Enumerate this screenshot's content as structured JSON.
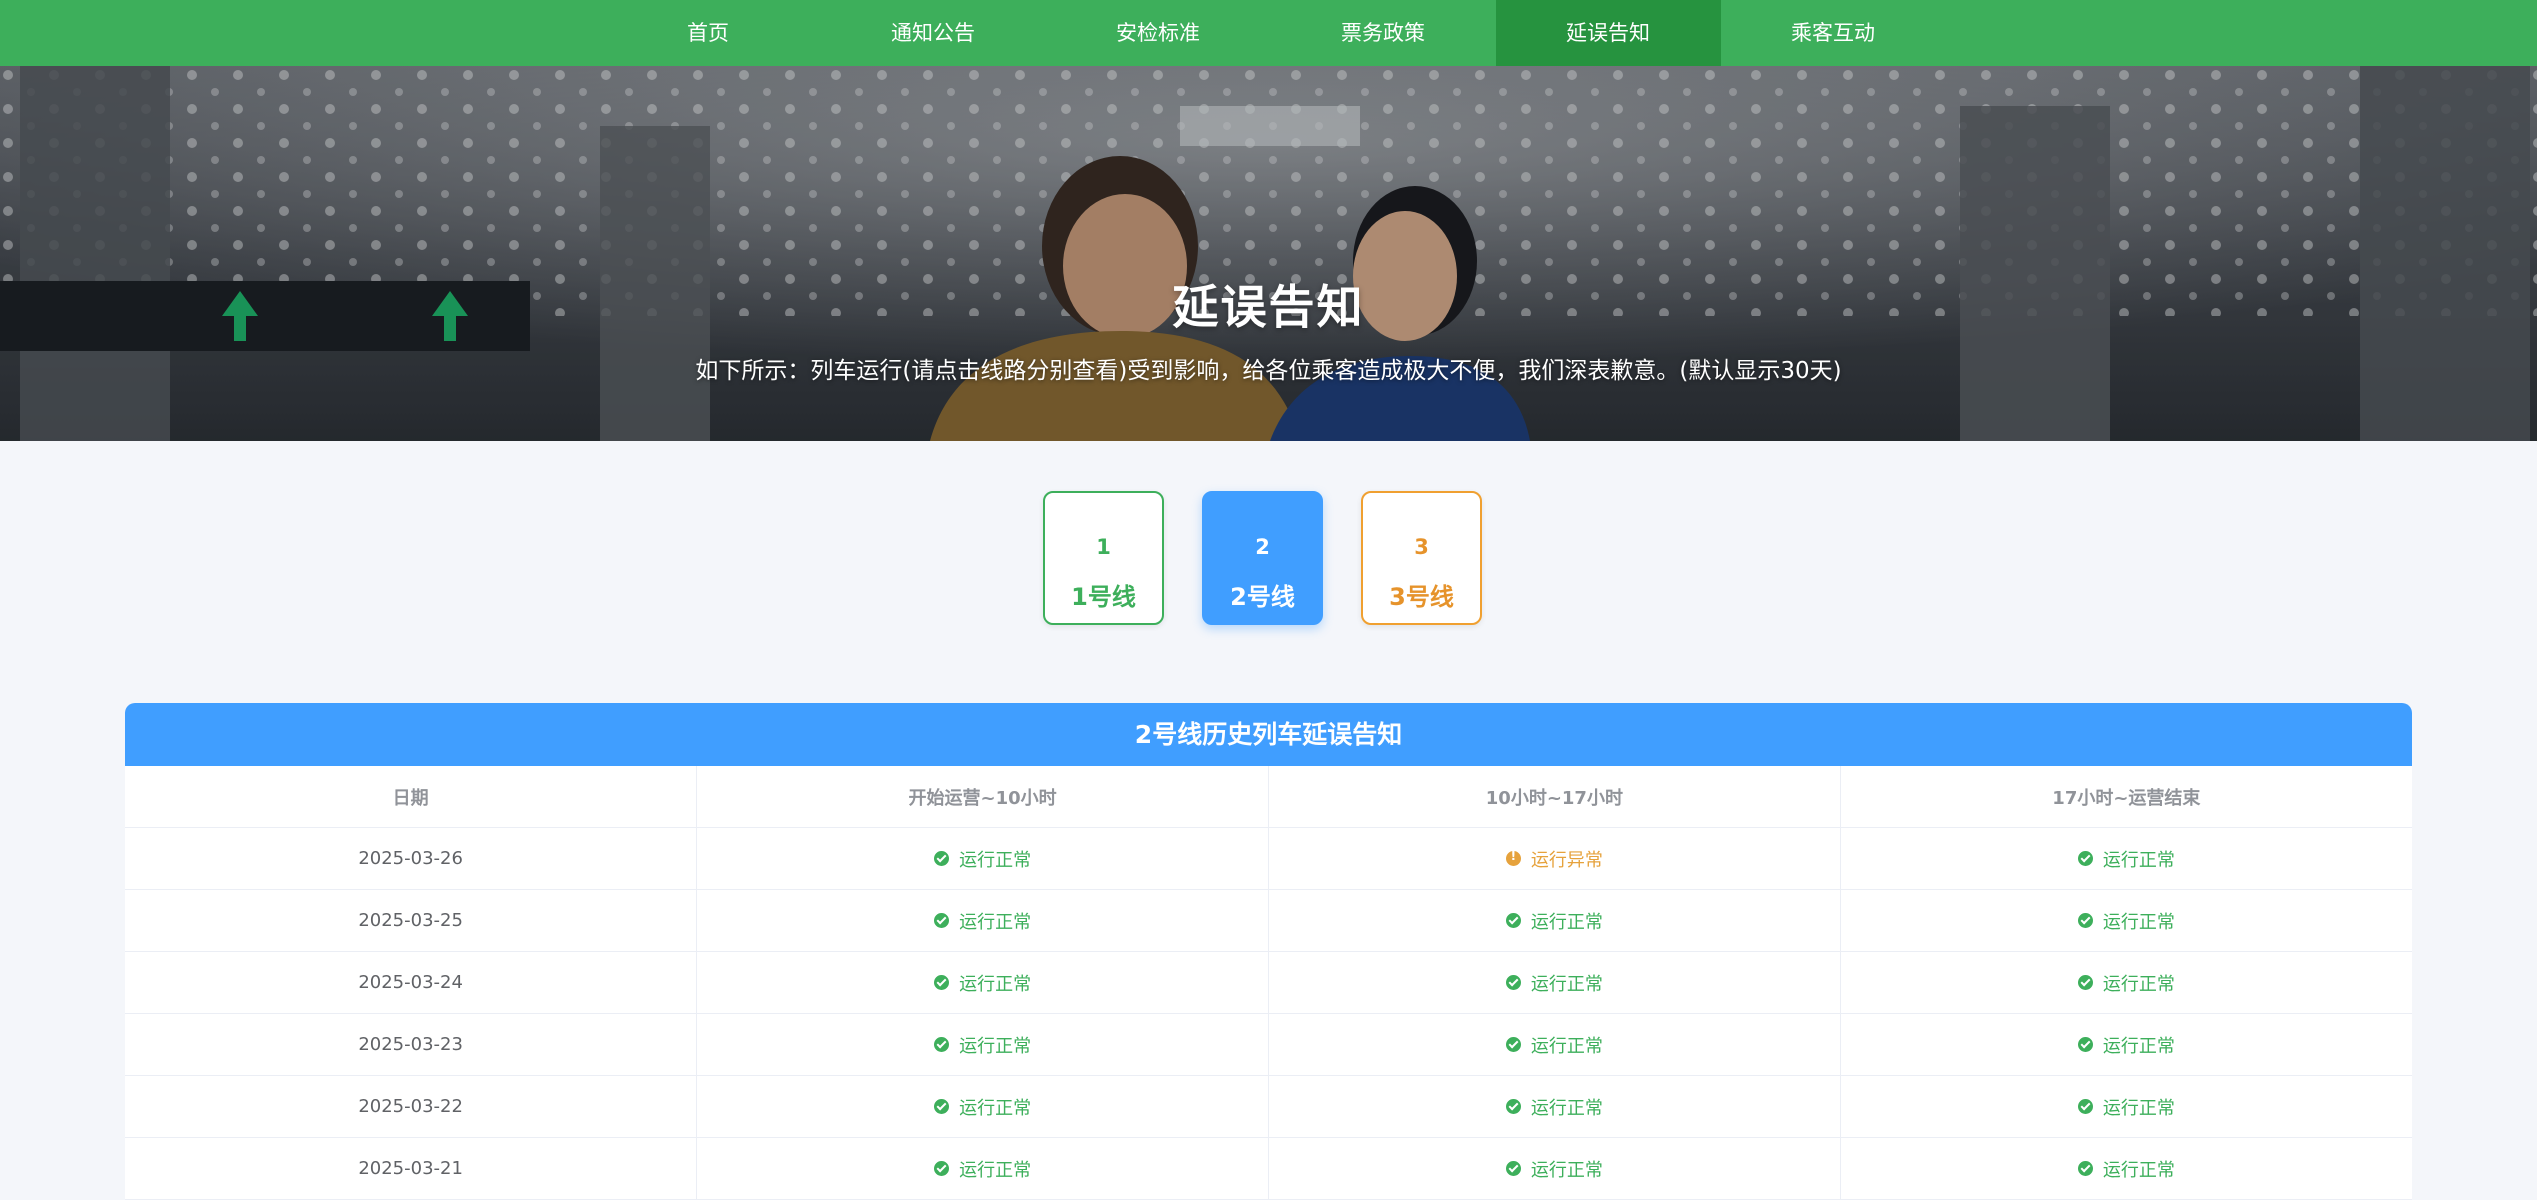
{
  "nav": {
    "items": [
      {
        "label": "首页"
      },
      {
        "label": "通知公告"
      },
      {
        "label": "安检标准"
      },
      {
        "label": "票务政策"
      },
      {
        "label": "延误告知"
      },
      {
        "label": "乘客互动"
      }
    ],
    "active": "延误告知"
  },
  "hero": {
    "title": "延误告知",
    "subtitle": "如下所示：列车运行(请点击线路分别查看)受到影响，给各位乘客造成极大不便，我们深表歉意。(默认显示30天)"
  },
  "lines": [
    {
      "num": "1",
      "label": "1号线"
    },
    {
      "num": "2",
      "label": "2号线"
    },
    {
      "num": "3",
      "label": "3号线"
    }
  ],
  "selected_line": "2",
  "table": {
    "title": "2号线历史列车延误告知",
    "headers": [
      "日期",
      "开始运营~10小时",
      "10小时~17小时",
      "17小时~运营结束"
    ],
    "rows": [
      {
        "date": "2025-03-26",
        "s1": "运行正常",
        "s2": "运行异常",
        "s3": "运行正常"
      },
      {
        "date": "2025-03-25",
        "s1": "运行正常",
        "s2": "运行正常",
        "s3": "运行正常"
      },
      {
        "date": "2025-03-24",
        "s1": "运行正常",
        "s2": "运行正常",
        "s3": "运行正常"
      },
      {
        "date": "2025-03-23",
        "s1": "运行正常",
        "s2": "运行正常",
        "s3": "运行正常"
      },
      {
        "date": "2025-03-22",
        "s1": "运行正常",
        "s2": "运行正常",
        "s3": "运行正常"
      },
      {
        "date": "2025-03-21",
        "s1": "运行正常",
        "s2": "运行正常",
        "s3": "运行正常"
      }
    ]
  },
  "colors": {
    "nav_bg": "#3daf5b",
    "nav_active": "#26933f",
    "accent_blue": "#409eff",
    "ok_green": "#3daf5b",
    "warn_orange": "#e6a23c"
  }
}
